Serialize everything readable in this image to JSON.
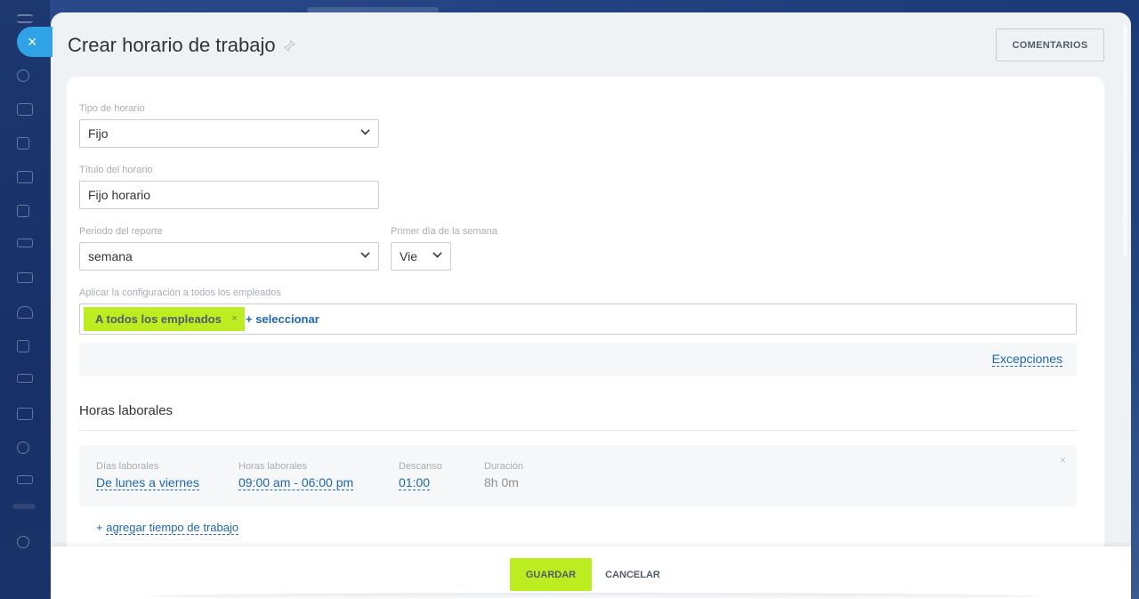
{
  "header": {
    "title": "Crear horario de trabajo",
    "comments_label": "COMENTARIOS"
  },
  "form": {
    "schedule_type": {
      "label": "Tipo de horario",
      "value": "Fijo"
    },
    "schedule_title": {
      "label": "Título del horario",
      "value": "Fijo horario"
    },
    "report_period": {
      "label": "Periodo del reporte",
      "value": "semana"
    },
    "first_day": {
      "label": "Primer día de la semana",
      "value": "Vie"
    },
    "apply_to": {
      "label": "Aplicar la configuración a todos los empleados",
      "tag": "A todos los empleados",
      "tag_remove": "×",
      "add_label": "+ seleccionar"
    },
    "exceptions_label": "Excepciones"
  },
  "working_hours": {
    "section_title": "Horas laborales",
    "row": {
      "days_label": "Días laborales",
      "days_value": "De lunes a viernes",
      "hours_label": "Horas laborales",
      "hours_value": "09:00 am - 06:00 pm",
      "break_label": "Descanso",
      "break_value": "01:00",
      "duration_label": "Duración",
      "duration_value": "8h 0m",
      "remove": "×"
    },
    "add_time_prefix": "+",
    "add_time_label": "agregar tiempo de trabajo"
  },
  "footer": {
    "save_label": "GUARDAR",
    "cancel_label": "CANCELAR"
  },
  "close_label": "×",
  "colors": {
    "accent_green": "#bbed21",
    "link_blue": "#2067b0",
    "close_blue": "#2fa3e6"
  }
}
